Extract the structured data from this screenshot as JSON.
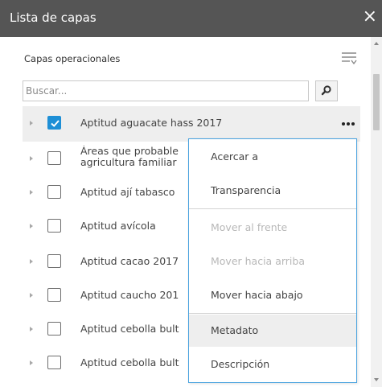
{
  "panel": {
    "title": "Lista de capas",
    "close_glyph": "×"
  },
  "section_label": "Capas operacionales",
  "search": {
    "placeholder": "Buscar..."
  },
  "layers": [
    {
      "label": "Aptitud aguacate hass 2017",
      "checked": true,
      "selected": true
    },
    {
      "label_line1": "Áreas que probable",
      "label_line2": "agricultura familiar",
      "checked": false
    },
    {
      "label": "Aptitud ají tabasco",
      "checked": false
    },
    {
      "label": "Aptitud avícola",
      "checked": false
    },
    {
      "label": "Aptitud cacao 2017",
      "checked": false
    },
    {
      "label": "Aptitud caucho 201",
      "checked": false
    },
    {
      "label": "Aptitud cebolla bult",
      "checked": false
    },
    {
      "label": "Aptitud cebolla bult",
      "checked": false
    }
  ],
  "context_menu": {
    "items": [
      {
        "label": "Acercar a",
        "enabled": true
      },
      {
        "label": "Transparencia",
        "enabled": true
      },
      {
        "label": "Mover al frente",
        "enabled": false
      },
      {
        "label": "Mover hacia arriba",
        "enabled": false
      },
      {
        "label": "Mover hacia abajo",
        "enabled": true
      },
      {
        "label": "Metadato",
        "enabled": true,
        "highlighted": true
      },
      {
        "label": "Descripción",
        "enabled": true
      }
    ]
  },
  "colors": {
    "titlebar": "#555555",
    "checkbox_checked": "#1e8fd6",
    "menu_border": "#4aa3df",
    "selected_row": "#eeeeee"
  },
  "icons": [
    "close-icon",
    "filter-icon",
    "search-icon",
    "expand-arrow-icon",
    "checkmark-icon",
    "more-options-icon"
  ]
}
